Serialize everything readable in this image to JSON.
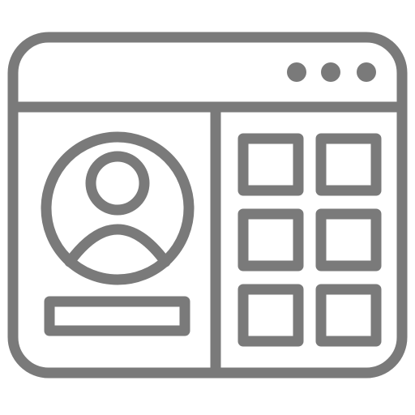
{
  "icon": {
    "name": "profile-window-icon",
    "stroke_color": "#7a7a7a",
    "background": "#ffffff"
  },
  "title_bar": {
    "dots": [
      "window-dot-1",
      "window-dot-2",
      "window-dot-3"
    ]
  },
  "profile_panel": {
    "avatar_icon": "user-avatar-icon",
    "name_bar": "name-placeholder-bar"
  },
  "grid_panel": {
    "tiles": [
      "grid-tile-1",
      "grid-tile-2",
      "grid-tile-3",
      "grid-tile-4",
      "grid-tile-5",
      "grid-tile-6"
    ]
  }
}
